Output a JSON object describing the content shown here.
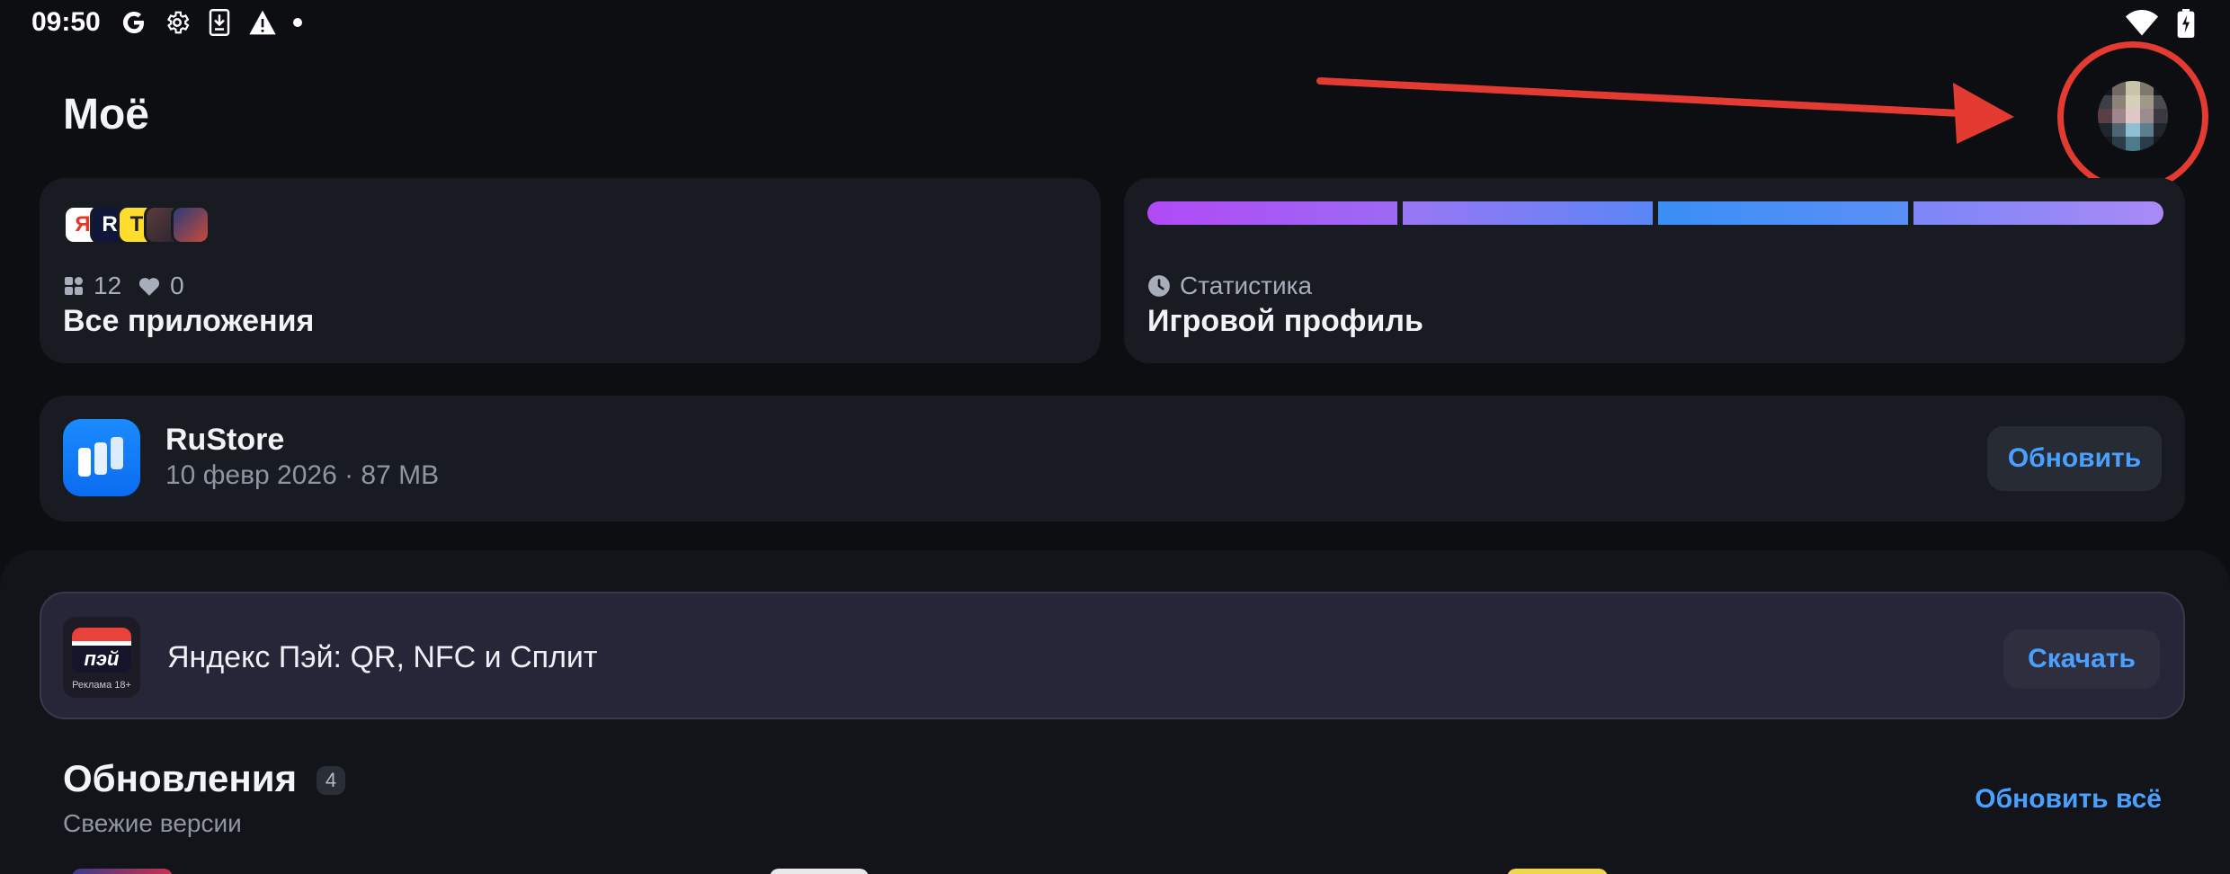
{
  "status_bar": {
    "time": "09:50",
    "icons": [
      "google-icon",
      "settings-icon",
      "download-icon",
      "warning-icon",
      "dot-icon",
      "wifi-icon",
      "battery-icon"
    ]
  },
  "page": {
    "title": "Моё"
  },
  "apps_card": {
    "apps_count": "12",
    "likes_count": "0",
    "title": "Все приложения"
  },
  "profile_card": {
    "subtitle": "Статистика",
    "title": "Игровой профиль"
  },
  "rustore": {
    "name": "RuStore",
    "meta": "10 февр 2026 · 87 MB",
    "button": "Обновить"
  },
  "ad": {
    "name": "Яндекс Пэй: QR, NFC и Сплит",
    "icon_text": "пэй",
    "icon_caption": "Реклама 18+",
    "button": "Скачать"
  },
  "updates": {
    "title": "Обновления",
    "count": "4",
    "subtitle": "Свежие версии",
    "update_all": "Обновить всё"
  },
  "colors": {
    "accent": "#4aa0ff",
    "annotation": "#e33a31"
  }
}
